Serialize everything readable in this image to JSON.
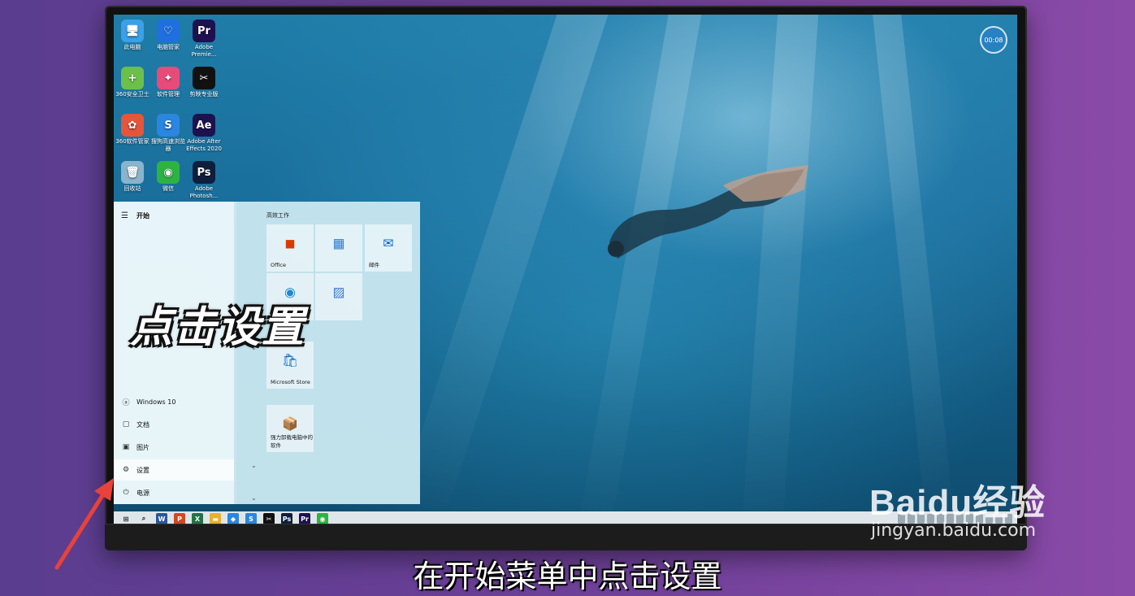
{
  "screen": {
    "clock_bubble": "00:08"
  },
  "desktop_icons": [
    {
      "label": "此电脑",
      "glyph": "🖥",
      "color": "#3aa0e8"
    },
    {
      "label": "电脑管家",
      "glyph": "♡",
      "color": "#1f6fe0"
    },
    {
      "label": "Adobe Premie...",
      "glyph": "Pr",
      "color": "#1e1150"
    },
    {
      "label": "360安全卫士",
      "glyph": "+",
      "color": "#6cc04a"
    },
    {
      "label": "软件管理",
      "glyph": "✦",
      "color": "#e84a7a"
    },
    {
      "label": "剪映专业版",
      "glyph": "✂",
      "color": "#111111"
    },
    {
      "label": "360软件管家",
      "glyph": "✿",
      "color": "#e6553a"
    },
    {
      "label": "搜狗高速浏览器",
      "glyph": "S",
      "color": "#2a86e0"
    },
    {
      "label": "Adobe After Effects 2020",
      "glyph": "Ae",
      "color": "#1e1150"
    },
    {
      "label": "回收站",
      "glyph": "🗑",
      "color": "#8ab4cc"
    },
    {
      "label": "微信",
      "glyph": "◉",
      "color": "#2db342"
    },
    {
      "label": "Adobe Photosh...",
      "glyph": "Ps",
      "color": "#0e1f3d"
    }
  ],
  "start_menu": {
    "title": "开始",
    "group_title": "高效工作",
    "left_items": [
      {
        "label": "Windows 10",
        "icon": "user-icon",
        "glyph": "ⓐ"
      },
      {
        "label": "文档",
        "icon": "document-icon",
        "glyph": "▢"
      },
      {
        "label": "图片",
        "icon": "picture-icon",
        "glyph": "▣"
      },
      {
        "label": "设置",
        "icon": "gear-icon",
        "glyph": "⚙"
      },
      {
        "label": "电源",
        "icon": "power-icon",
        "glyph": "⏻"
      }
    ],
    "tiles": [
      {
        "label": "Office",
        "glyph": "◼",
        "color": "#d83b01"
      },
      {
        "label": "",
        "glyph": "▦",
        "color": "#2b7cd3"
      },
      {
        "label": "邮件",
        "glyph": "✉",
        "color": "#0a64c8"
      },
      {
        "label": "",
        "glyph": "◉",
        "color": "#1a8ad4"
      },
      {
        "label": "",
        "glyph": "▨",
        "color": "#3a7ad4"
      },
      {
        "label": "Microsoft Store",
        "glyph": "🛍",
        "color": "#1a6fd0"
      },
      {
        "label": "强力卸载电脑中的软件",
        "glyph": "📦",
        "color": "#d8a030"
      }
    ]
  },
  "taskbar": {
    "items": [
      {
        "name": "start-icon",
        "glyph": "⊞",
        "color": "#111111"
      },
      {
        "name": "search-icon",
        "glyph": "⌕",
        "color": "#111111"
      },
      {
        "name": "word-icon",
        "glyph": "W",
        "color": "#2b579a"
      },
      {
        "name": "powerpoint-icon",
        "glyph": "P",
        "color": "#d24726"
      },
      {
        "name": "excel-icon",
        "glyph": "X",
        "color": "#217346"
      },
      {
        "name": "file-explorer-icon",
        "glyph": "▬",
        "color": "#e8b030"
      },
      {
        "name": "app-icon",
        "glyph": "◆",
        "color": "#2a86e0"
      },
      {
        "name": "sogou-icon",
        "glyph": "S",
        "color": "#2a86e0"
      },
      {
        "name": "capcut-icon",
        "glyph": "✂",
        "color": "#111111"
      },
      {
        "name": "photoshop-icon",
        "glyph": "Ps",
        "color": "#0e1f3d"
      },
      {
        "name": "premiere-icon",
        "glyph": "Pr",
        "color": "#1e1150"
      },
      {
        "name": "app-green-icon",
        "glyph": "◉",
        "color": "#2db342"
      }
    ]
  },
  "overlay": {
    "big_caption": "点击设置",
    "subtitle": "在开始菜单中点击设置",
    "watermark_brand": "Baidu经验",
    "watermark_url": "jingyan.baidu.com"
  }
}
